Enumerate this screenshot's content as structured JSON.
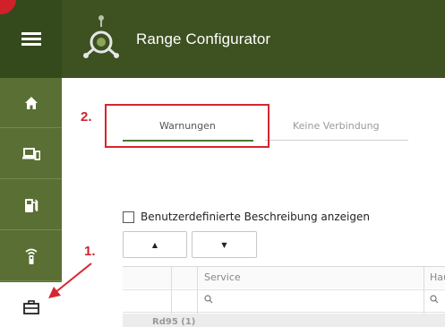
{
  "header": {
    "title": "Range Configurator"
  },
  "sidebar": {
    "items": [
      {
        "icon": "home-icon"
      },
      {
        "icon": "devices-icon"
      },
      {
        "icon": "fuel-icon"
      },
      {
        "icon": "remote-icon"
      },
      {
        "icon": "toolbox-icon",
        "active": true
      }
    ]
  },
  "annotations": {
    "step1": "1.",
    "step2": "2.",
    "color": "#d6262f"
  },
  "tabs": [
    {
      "label": "Warnungen",
      "active": true
    },
    {
      "label": "Keine Verbindung",
      "active": false
    }
  ],
  "options": {
    "custom_description_label": "Benutzerdefinierte Beschreibung anzeigen",
    "custom_description_checked": false
  },
  "sort_buttons": {
    "up": "▲",
    "down": "▼"
  },
  "grid": {
    "columns": [
      "Service",
      "Hau"
    ],
    "group_label": "Rd95 (1)"
  },
  "colors": {
    "header": "#3d5121",
    "sidebar": "#5a6f34",
    "active_tab_underline": "#4a7a2e"
  }
}
